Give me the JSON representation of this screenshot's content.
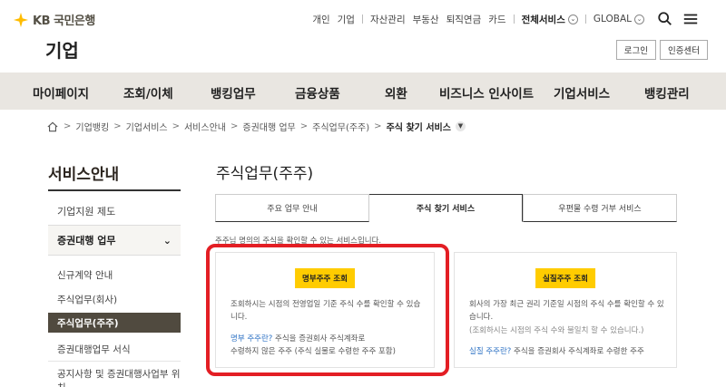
{
  "header": {
    "logo_text": "KB 국민은행",
    "page_heading": "기업",
    "topnav": [
      "개인",
      "기업",
      "자산관리",
      "부동산",
      "퇴직연금",
      "카드"
    ],
    "all_services": "전체서비스",
    "global": "GLOBAL",
    "login": "로그인",
    "cert_center": "인증센터"
  },
  "mainnav": [
    "마이페이지",
    "조회/이체",
    "뱅킹업무",
    "금융상품",
    "외환",
    "비즈니스 인사이트",
    "기업서비스",
    "뱅킹관리"
  ],
  "breadcrumb": {
    "items": [
      "기업뱅킹",
      "기업서비스",
      "서비스안내",
      "증권대행 업무",
      "주식업무(주주)"
    ],
    "current": "주식 찾기 서비스"
  },
  "sidebar": {
    "title": "서비스안내",
    "item_support": "기업지원 제도",
    "group": "증권대행 업무",
    "sub_items": [
      "신규계약 안내",
      "주식업무(회사)",
      "주식업무(주주)",
      "증권대행업무 서식",
      "공지사항 및 증권대행사업부 위치"
    ]
  },
  "content": {
    "title": "주식업무(주주)",
    "tabs": [
      "주요 업무 안내",
      "주식 찾기 서비스",
      "우편물 수령 거부 서비스"
    ],
    "description": "주주님 명의의 주식을 확인할 수 있는 서비스입니다.",
    "card1": {
      "button": "명부주주 조회",
      "text": "조회하시는 시점의 전영업일 기준 주식 수를 확인할 수 있습니다.",
      "link": "명부 주주란?",
      "link_text": "주식을 증권회사 주식계좌로",
      "link_text2": "수령하지 않은 주주 (주식 실물로 수령한 주주 포함)"
    },
    "card2": {
      "button": "실질주주 조회",
      "text": "회사의 가장 최근 권리 기준일 시점의 주식 수를 확인할 수 있습니다.",
      "note": "(조회하시는 시점의 주식 수와 불일치 할 수 있습니다.)",
      "link": "실질 주주란?",
      "link_text": "주식을 증권회사 주식계좌로 수령한 주주"
    }
  },
  "colors": {
    "accent_yellow": "#ffcc00",
    "nav_bg": "#e9e6e1",
    "active_side": "#504a3f",
    "highlight": "#e31e24",
    "link": "#2f73c4"
  }
}
